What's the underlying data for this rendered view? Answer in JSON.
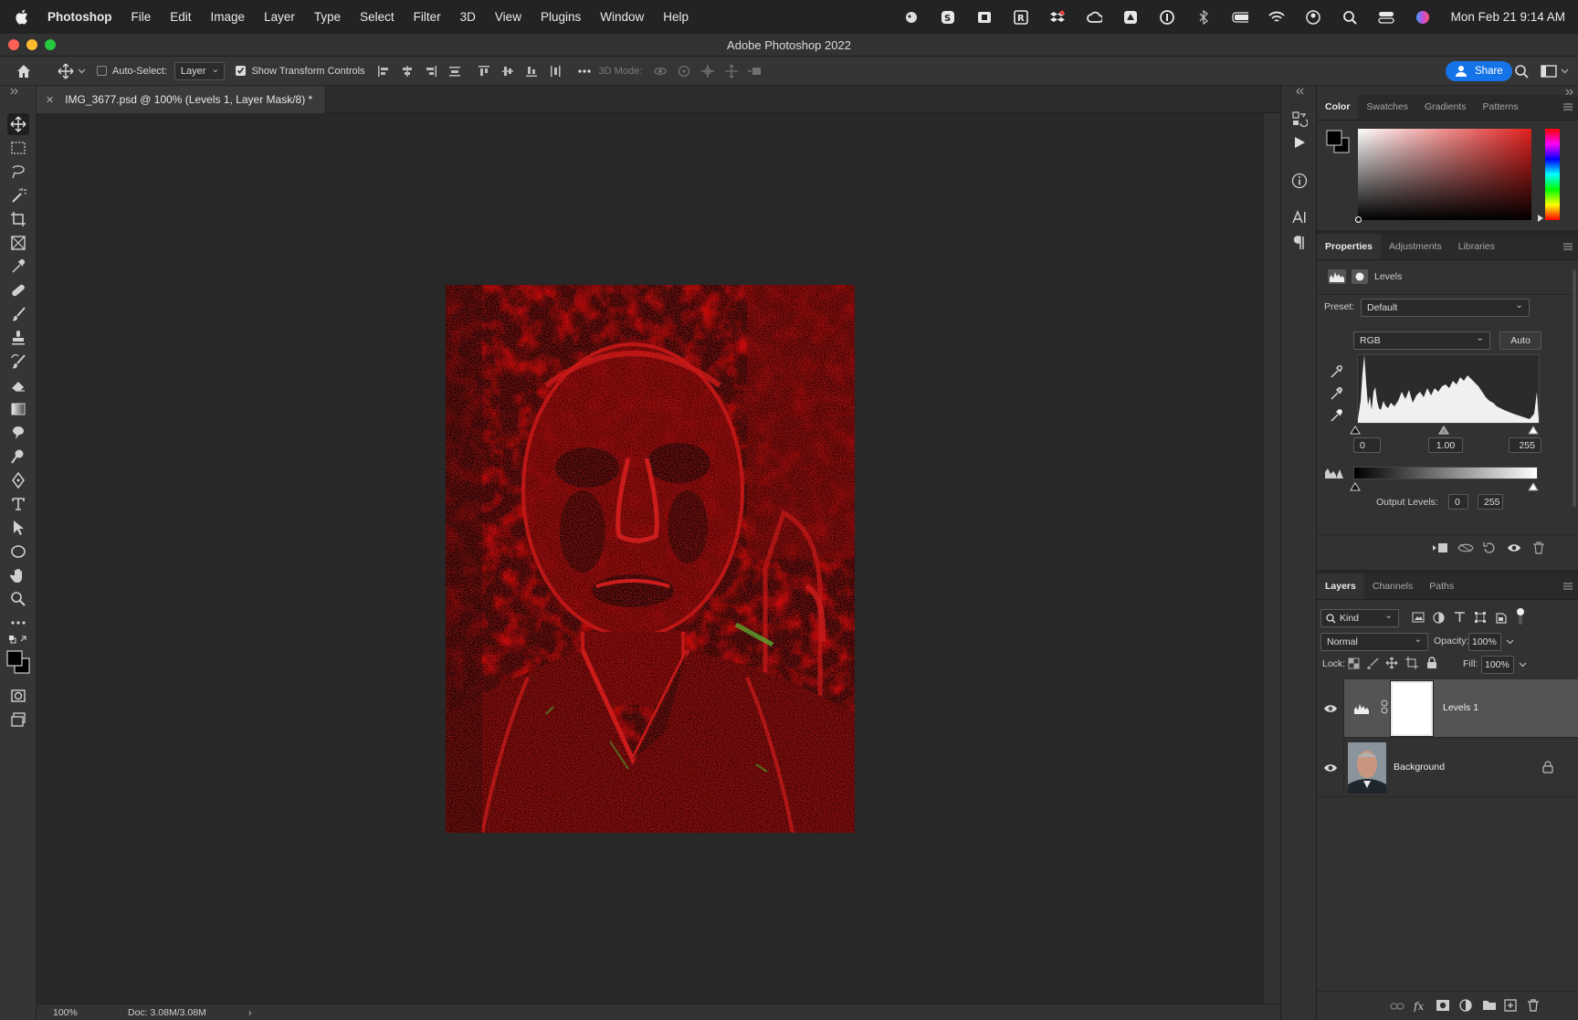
{
  "menubar": {
    "app_name": "Photoshop",
    "items": [
      "File",
      "Edit",
      "Image",
      "Layer",
      "Type",
      "Select",
      "Filter",
      "3D",
      "View",
      "Plugins",
      "Window",
      "Help"
    ],
    "clock": "Mon Feb 21  9:14 AM"
  },
  "window": {
    "title": "Adobe Photoshop 2022"
  },
  "options": {
    "auto_select_label": "Auto-Select:",
    "auto_select_checked": false,
    "auto_select_target": "Layer",
    "transform_label": "Show Transform Controls",
    "transform_checked": true,
    "mode_3d_label": "3D Mode:",
    "share_label": "Share"
  },
  "document": {
    "tab_title": "IMG_3677.psd @ 100% (Levels 1, Layer Mask/8) *",
    "zoom": "100%",
    "doc_size": "Doc: 3.08M/3.08M"
  },
  "color_panel": {
    "tabs": [
      "Color",
      "Swatches",
      "Gradients",
      "Patterns"
    ],
    "active_tab": "Color",
    "hue_color": "#e0201e"
  },
  "properties_panel": {
    "tabs": [
      "Properties",
      "Adjustments",
      "Libraries"
    ],
    "active_tab": "Properties",
    "adjustment_name": "Levels",
    "preset_label": "Preset:",
    "preset_value": "Default",
    "channel_value": "RGB",
    "auto_label": "Auto",
    "input_black": "0",
    "input_gamma": "1.00",
    "input_white": "255",
    "output_label": "Output Levels:",
    "output_black": "0",
    "output_white": "255"
  },
  "layers_panel": {
    "tabs": [
      "Layers",
      "Channels",
      "Paths"
    ],
    "active_tab": "Layers",
    "filter_kind": "Kind",
    "blend_mode": "Normal",
    "opacity_label": "Opacity:",
    "opacity_value": "100%",
    "lock_label": "Lock:",
    "fill_label": "Fill:",
    "fill_value": "100%",
    "layers": [
      {
        "name": "Levels 1",
        "selected": true
      },
      {
        "name": "Background",
        "selected": false
      }
    ]
  }
}
